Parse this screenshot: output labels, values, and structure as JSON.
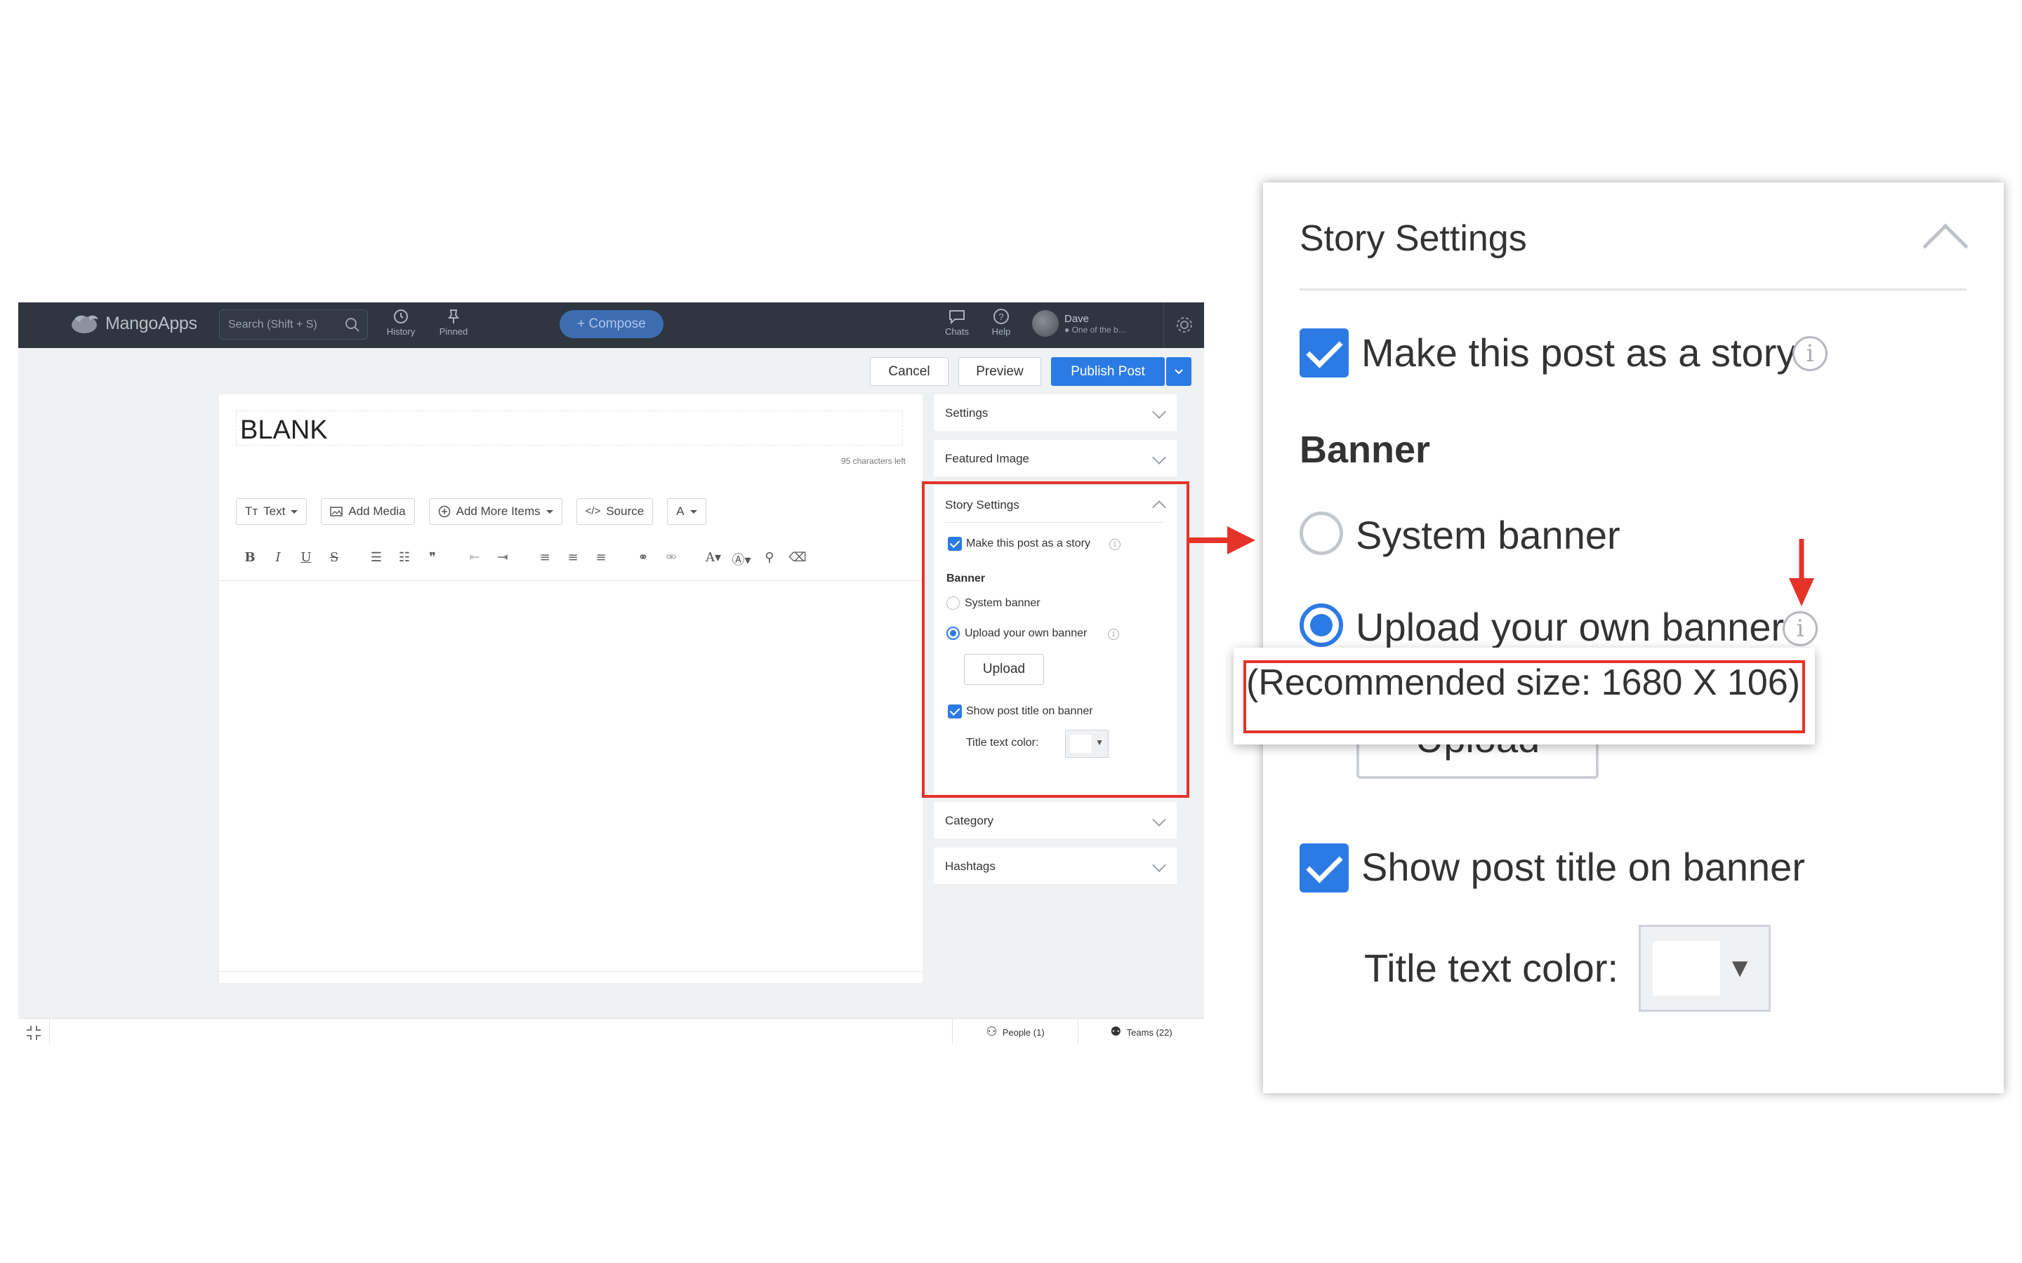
{
  "app": {
    "logo_text": "MangoApps",
    "search_placeholder": "Search (Shift + S)",
    "nav": {
      "history": "History",
      "pinned": "Pinned"
    },
    "compose_label": "+ Compose",
    "chats": "Chats",
    "help": "Help",
    "user_name": "Dave",
    "user_status": "One of the b…",
    "actions": {
      "cancel": "Cancel",
      "preview": "Preview",
      "publish": "Publish Post"
    }
  },
  "editor": {
    "title": "BLANK",
    "chars_left": "95 characters left",
    "toolbar": {
      "text": "Text",
      "add_media": "Add Media",
      "add_more": "Add More Items",
      "source": "Source",
      "font": "A"
    },
    "format_icons": [
      "B",
      "I",
      "U",
      "S"
    ]
  },
  "sidebar": {
    "settings": "Settings",
    "featured_image": "Featured Image",
    "category": "Category",
    "hashtags": "Hashtags",
    "story": {
      "title": "Story Settings",
      "make_story": "Make this post as a story",
      "make_story_checked": true,
      "banner_heading": "Banner",
      "system_banner": "System banner",
      "upload_banner": "Upload your own banner",
      "selected_banner": "upload",
      "upload_button": "Upload",
      "show_title": "Show post title on banner",
      "show_title_checked": true,
      "title_color_label": "Title text color:",
      "title_color": "#ffffff"
    }
  },
  "footer": {
    "people": "People (1)",
    "teams": "Teams (22)"
  },
  "tooltip": {
    "text": "(Recommended size: 1680 X 106)"
  },
  "colors": {
    "accent": "#2c7be5",
    "highlight": "#e5332a",
    "topbar": "#2f3640"
  }
}
